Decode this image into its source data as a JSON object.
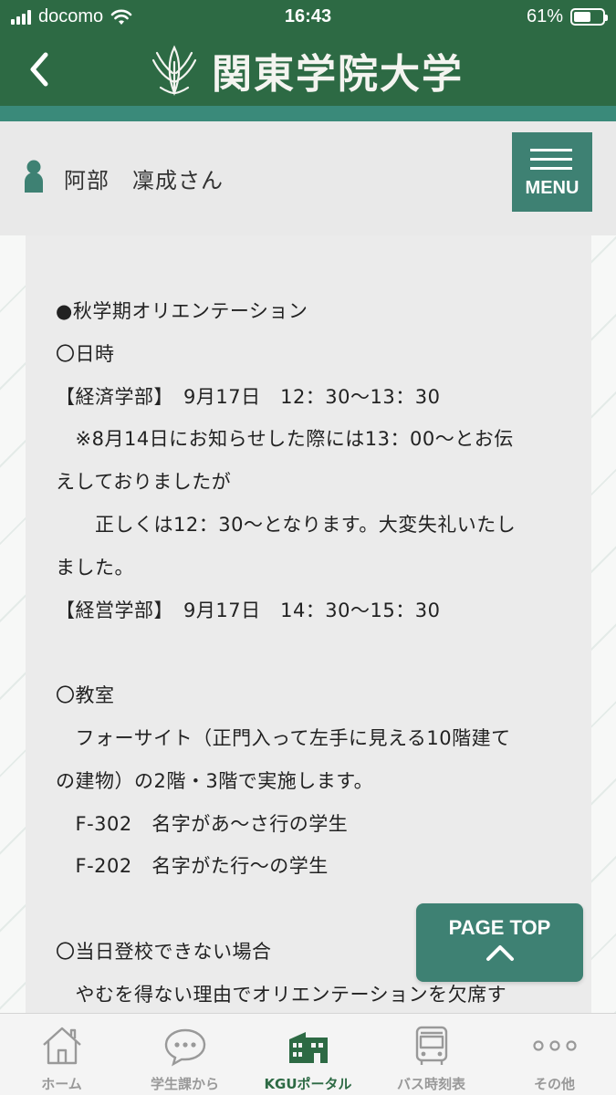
{
  "status_bar": {
    "carrier": "docomo",
    "time": "16:43",
    "battery": "61%",
    "battery_level": 0.61
  },
  "header": {
    "title": "関東学院大学"
  },
  "user": {
    "name": "阿部　凜成さん"
  },
  "menu": {
    "label": "MENU"
  },
  "content": {
    "lines": [
      "●秋学期オリエンテーション",
      "〇日時",
      "【経済学部】　9月17日　12：30〜13：30",
      "　※8月14日にお知らせした際には13：00〜とお伝",
      "えしておりましたが",
      "　　正しくは12：30〜となります。大変失礼いたし",
      "ました。",
      "【経営学部】　9月17日　14：30〜15：30",
      "",
      "〇教室",
      "　フォーサイト（正門入って左手に見える10階建て",
      "の建物）の2階・3階で実施します。",
      "　F-302　名字があ〜さ行の学生",
      "　F-202　名字がた行〜の学生",
      "",
      "〇当日登校できない場合",
      "　やむを得ない理由でオリエンテーションを欠席す"
    ]
  },
  "page_top": {
    "label": "PAGE TOP"
  },
  "tabs": [
    {
      "label": "ホーム",
      "icon": "home-icon"
    },
    {
      "label": "学生課から",
      "icon": "speech-bubble-icon"
    },
    {
      "label": "KGUポータル",
      "icon": "building-icon",
      "active": true
    },
    {
      "label": "バス時刻表",
      "icon": "bus-icon"
    },
    {
      "label": "その他",
      "icon": "more-icon"
    }
  ],
  "colors": {
    "header_green": "#2d6a44",
    "accent_teal": "#3e8173",
    "strip_teal": "#3a8a7a",
    "active_tab": "#2d6a44",
    "inactive_tab": "#999999"
  }
}
